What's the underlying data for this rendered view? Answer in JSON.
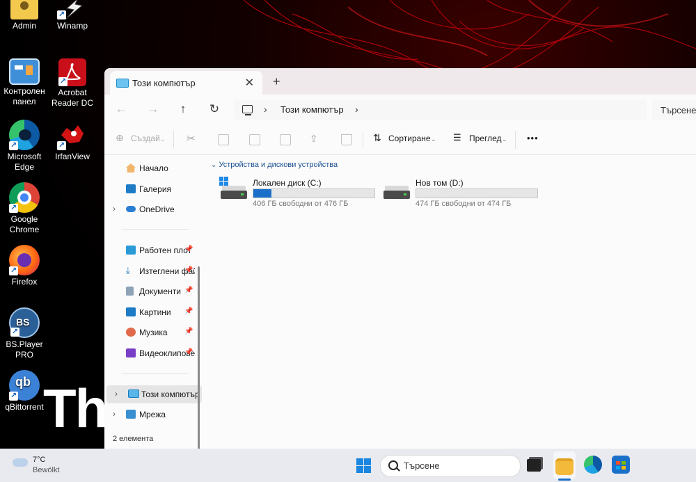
{
  "desktop": {
    "brand_text": "Thi",
    "icons": [
      {
        "label": "Admin",
        "icon": "user-folder-icon"
      },
      {
        "label": "Winamp",
        "icon": "winamp-icon"
      },
      {
        "label": "Контролен панел",
        "icon": "control-panel-icon"
      },
      {
        "label": "Acrobat Reader DC",
        "icon": "acrobat-icon"
      },
      {
        "label": "Microsoft Edge",
        "icon": "edge-icon"
      },
      {
        "label": "IrfanView",
        "icon": "irfanview-icon"
      },
      {
        "label": "Google Chrome",
        "icon": "chrome-icon"
      },
      {
        "label": "Firefox",
        "icon": "firefox-icon"
      },
      {
        "label": "BS.Player PRO",
        "icon": "bsplayer-icon"
      },
      {
        "label": "qBittorrent",
        "icon": "qbittorrent-icon"
      }
    ]
  },
  "explorer": {
    "tab_title": "Този компютър",
    "address_path": "Този компютър",
    "search_placeholder": "Търсене",
    "toolbar": {
      "new": "Създай",
      "sort": "Сортиране",
      "view": "Преглед",
      "more": "•••"
    },
    "nav": {
      "home": "Начало",
      "gallery": "Галерия",
      "onedrive": "OneDrive",
      "quick": [
        {
          "label": "Работен плот",
          "icon": "desktop-icon"
        },
        {
          "label": "Изтеглени файлове",
          "icon": "download-icon"
        },
        {
          "label": "Документи",
          "icon": "documents-icon"
        },
        {
          "label": "Картини",
          "icon": "pictures-icon"
        },
        {
          "label": "Музика",
          "icon": "music-icon"
        },
        {
          "label": "Видеоклипове",
          "icon": "videos-icon"
        }
      ],
      "this_pc": "Този компютър",
      "network": "Мрежа"
    },
    "group_header": "Устройства и дискови устройства",
    "drives": [
      {
        "name": "Локален диск (C:)",
        "free": "406 ГБ свободни от 476 ГБ",
        "used_fraction": 0.147
      },
      {
        "name": "Нов том (D:)",
        "free": "474 ГБ свободни от 474 ГБ",
        "used_fraction": 0.0
      }
    ],
    "status": "2 елемента"
  },
  "taskbar": {
    "weather_temp": "7°C",
    "weather_desc": "Bewölkt",
    "search_label": "Търсене"
  }
}
